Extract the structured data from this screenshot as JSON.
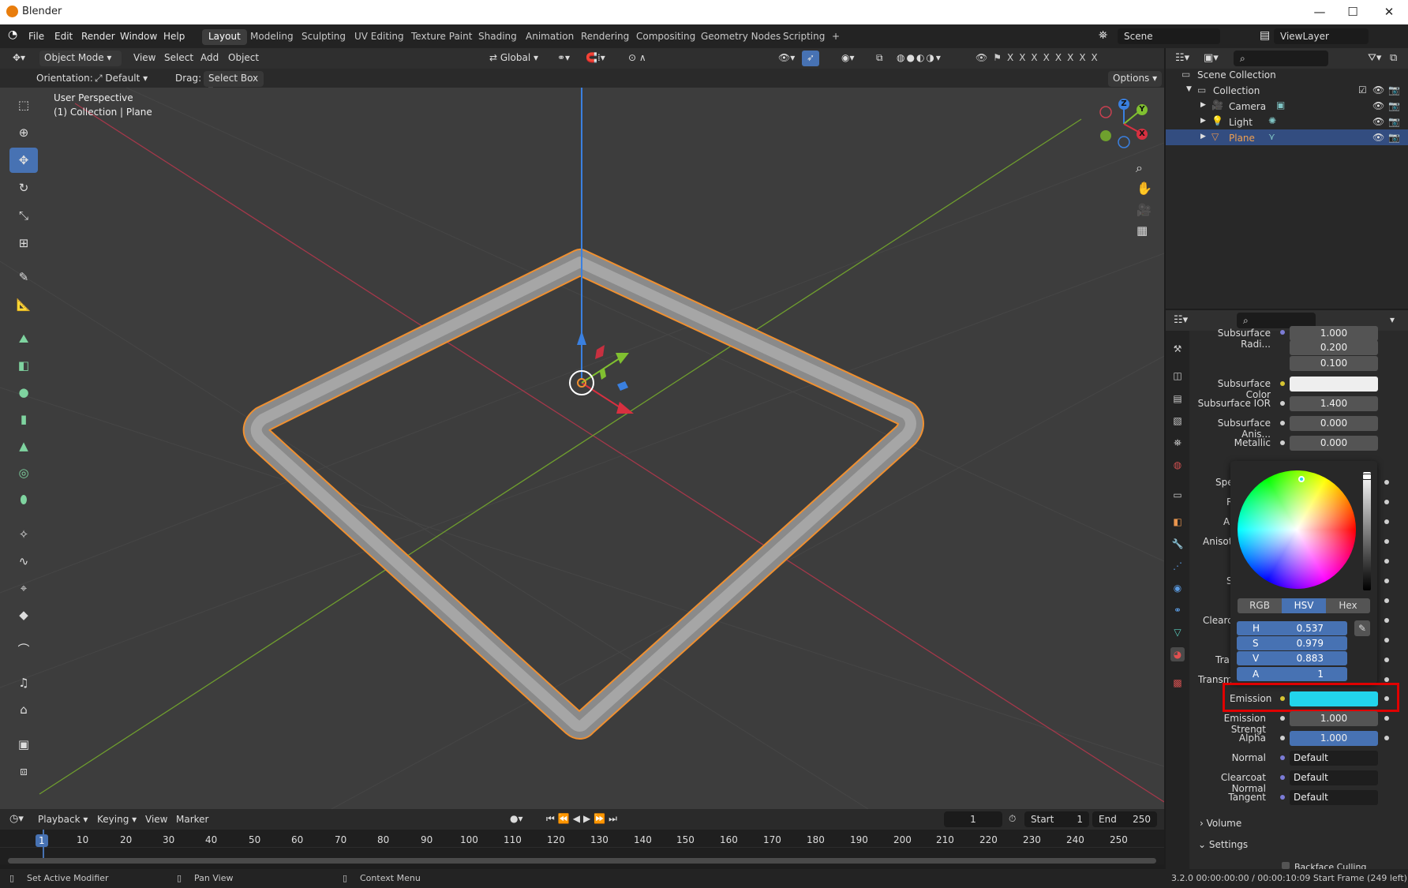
{
  "window": {
    "title": "Blender",
    "minimize": "—",
    "maximize": "☐",
    "close": "✕"
  },
  "menu": [
    "File",
    "Edit",
    "Render",
    "Window",
    "Help"
  ],
  "workspaces": [
    "Layout",
    "Modeling",
    "Sculpting",
    "UV Editing",
    "Texture Paint",
    "Shading",
    "Animation",
    "Rendering",
    "Compositing",
    "Geometry Nodes",
    "Scripting",
    "+"
  ],
  "scene": {
    "name": "Scene",
    "view_layer": "ViewLayer"
  },
  "viewport_header": {
    "mode": "Object Mode",
    "view": "View",
    "select": "Select",
    "add": "Add",
    "object": "Object",
    "transform": "Global",
    "options": "Options"
  },
  "tool_settings": {
    "orientation_label": "Orientation:",
    "orientation": "Default",
    "drag_label": "Drag:",
    "drag": "Select Box"
  },
  "viewport": {
    "perspective": "User Perspective",
    "context": "(1) Collection | Plane"
  },
  "gizmo": {
    "z": "Z",
    "y": "Y",
    "x": "X"
  },
  "outliner": {
    "root": "Scene Collection",
    "collection": "Collection",
    "items": [
      {
        "name": "Camera"
      },
      {
        "name": "Light"
      },
      {
        "name": "Plane"
      }
    ]
  },
  "properties": {
    "subsurface_radius_label": "Subsurface Radi...",
    "subsurface_radius": [
      "1.000",
      "0.200",
      "0.100"
    ],
    "rows": [
      {
        "label": "Subsurface Color",
        "value": ""
      },
      {
        "label": "Subsurface IOR",
        "value": "1.400"
      },
      {
        "label": "Subsurface Anis...",
        "value": "0.000"
      },
      {
        "label": "Metallic",
        "value": "0.000"
      }
    ],
    "hidden_labels": [
      "Specular",
      "Spe",
      "R",
      "A",
      "Anisotr",
      "S",
      "Clearco",
      "Tra",
      "Transmi"
    ],
    "emission_label": "Emission",
    "emission_color": "#22d4ec",
    "emission_strength_label": "Emission Strengt",
    "emission_strength": "1.000",
    "alpha_label": "Alpha",
    "alpha": "1.000",
    "normal_label": "Normal",
    "normal": "Default",
    "clearcoat_normal_label": "Clearcoat Normal",
    "clearcoat_normal": "Default",
    "tangent_label": "Tangent",
    "tangent": "Default",
    "volume": "Volume",
    "settings": "Settings",
    "backface_culling": "Backface Culling"
  },
  "color_picker": {
    "modes": [
      "RGB",
      "HSV",
      "Hex"
    ],
    "active_mode": "HSV",
    "h_label": "H",
    "h": "0.537",
    "s_label": "S",
    "s": "0.979",
    "v_label": "V",
    "v": "0.883",
    "a_label": "A",
    "a": "1"
  },
  "timeline": {
    "playback": "Playback",
    "keying": "Keying",
    "view": "View",
    "marker": "Marker",
    "current_frame": "1",
    "start_label": "Start",
    "start": "1",
    "end_label": "End",
    "end": "250",
    "ticks": [
      "1",
      "10",
      "20",
      "30",
      "40",
      "50",
      "60",
      "70",
      "80",
      "90",
      "100",
      "110",
      "120",
      "130",
      "140",
      "150",
      "160",
      "170",
      "180",
      "190",
      "200",
      "210",
      "220",
      "230",
      "240",
      "250"
    ]
  },
  "status": {
    "left": "Set Active Modifier",
    "middle": "Pan View",
    "right": "Context Menu",
    "info": "3.2.0  00:00:00:00 / 00:00:10:09  Start Frame (249 left)"
  },
  "colors": {
    "accent": "#4772b3",
    "selection_outline": "#f09030",
    "highlight_box": "#e00000"
  }
}
